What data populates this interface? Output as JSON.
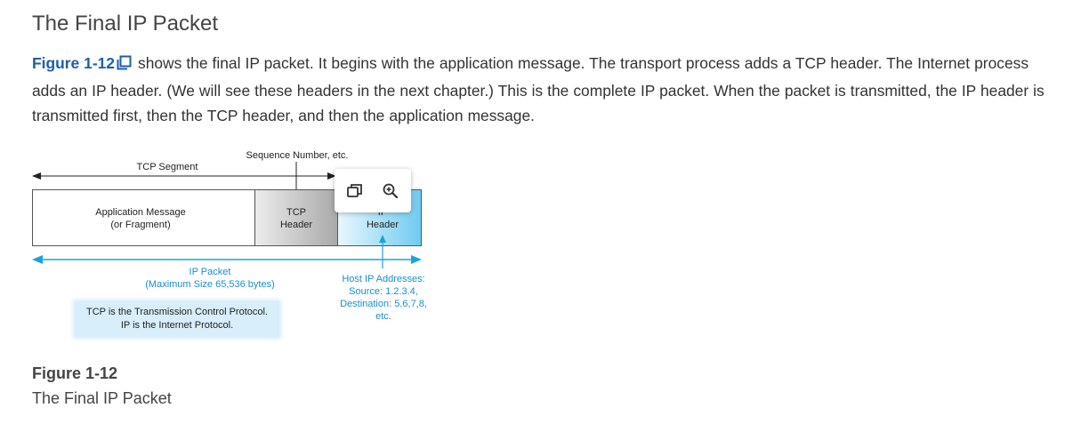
{
  "page": {
    "heading": "The Final IP Packet",
    "paragraph": {
      "figure_link": "Figure 1-12",
      "text": " shows the final IP packet. It begins with the application message. The transport process adds a TCP header. The Internet process adds an IP header. (We will see these headers in the next chapter.) This is the complete IP packet. When the packet is transmitted, the IP header is transmitted first, then the TCP header, and then the application message.",
      "link_icon": "open-in-new-window-icon"
    },
    "figure": {
      "tcp_segment_label": "TCP Segment",
      "sequence_label": "Sequence Number, etc.",
      "app_message_line1": "Application Message",
      "app_message_line2": "(or Fragment)",
      "tcp_header_line1": "TCP",
      "tcp_header_line2": "Header",
      "ip_header_line1": "IP",
      "ip_header_line2": "Header",
      "ip_packet_line1": "IP Packet",
      "ip_packet_line2": "(Maximum Size 65,536 bytes)",
      "host_line1": "Host IP Addresses:",
      "host_line2": "Source: 1.2.3.4,",
      "host_line3": "Destination: 5,6,7,8,",
      "host_line4": "etc.",
      "note_line1": "TCP is the Transmission Control Protocol.",
      "note_line2": "IP is the Internet Protocol.",
      "colors": {
        "accent_blue": "#1aa3d9",
        "tcp_gray": "#bdbdbd",
        "ip_blue": "#8fd3f0",
        "note_bg": "#d6eefa"
      }
    },
    "toolbar": {
      "open_icon": "open-in-window-icon",
      "zoom_icon": "zoom-in-icon"
    },
    "caption": {
      "number": "Figure 1-12",
      "title": "The Final IP Packet"
    }
  }
}
